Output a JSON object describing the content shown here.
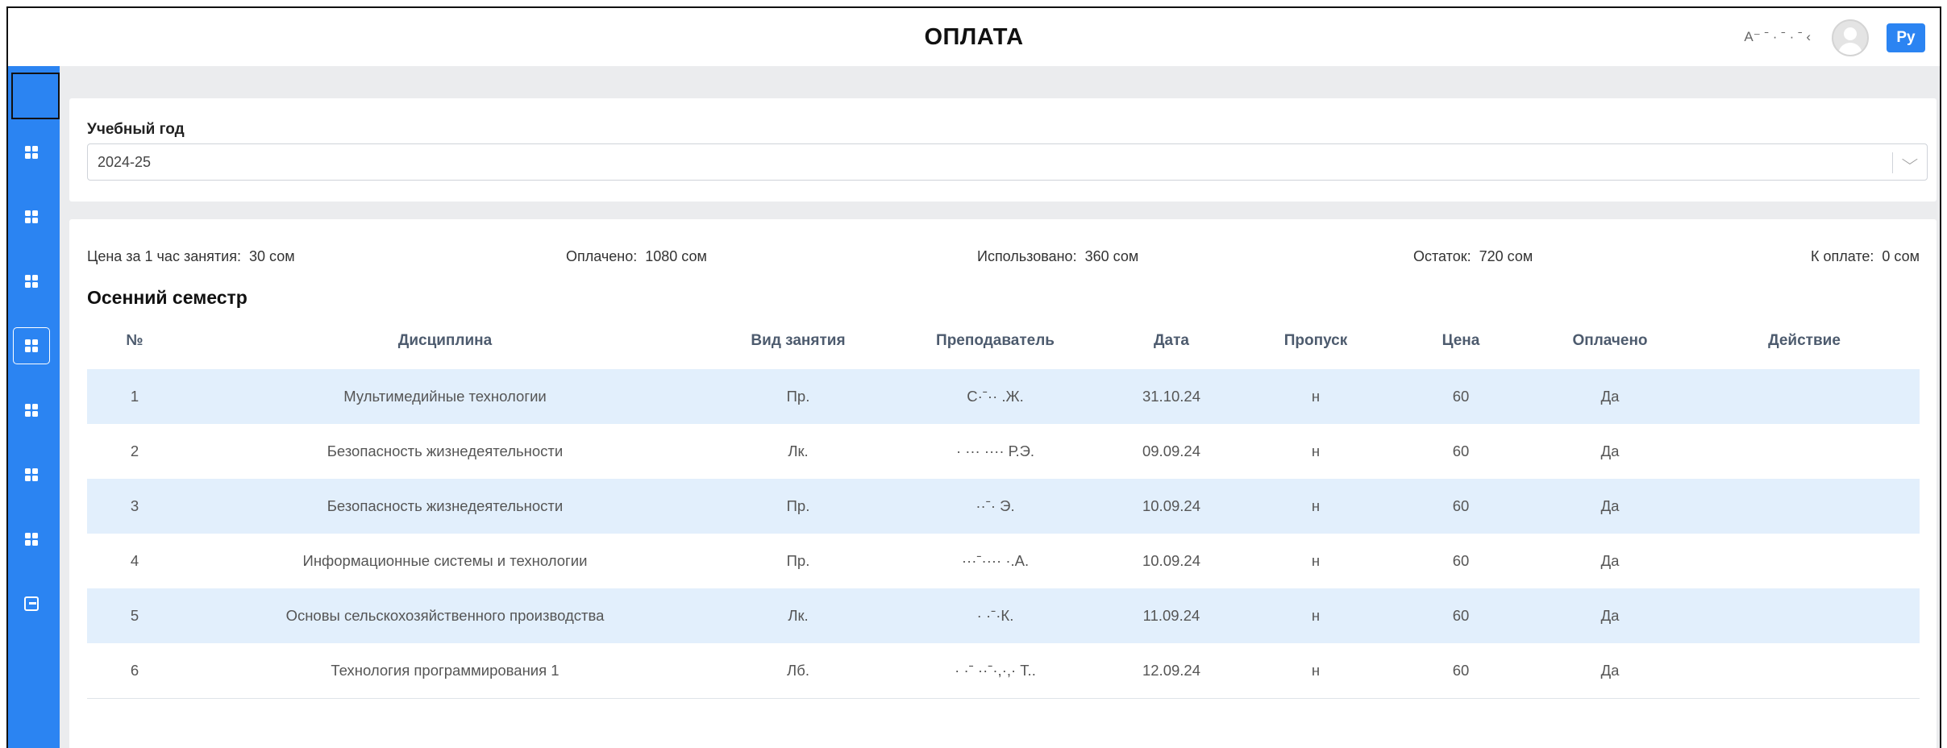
{
  "header": {
    "title": "ОПЛАТА",
    "user_name": "А⁻ ˉ · ˉ · ˉ  ‹",
    "lang_label": "Ру"
  },
  "sidebar": {
    "icons": [
      "grid-icon",
      "grid-icon",
      "grid-icon",
      "grid-icon",
      "grid-icon",
      "grid-icon",
      "grid-icon",
      "exit-icon"
    ],
    "active_index": 3
  },
  "filter": {
    "label": "Учебный год",
    "value": "2024-25",
    "chevron": "⌵"
  },
  "summary": {
    "price_label": "Цена за 1 час занятия:",
    "price_value": "30 сом",
    "paid_label": "Оплачено:",
    "paid_value": "1080 сом",
    "used_label": "Использовано:",
    "used_value": "360 сом",
    "rest_label": "Остаток:",
    "rest_value": "720 сом",
    "due_label": "К оплате:",
    "due_value": "0 сом"
  },
  "semester_title": "Осенний семестр",
  "table": {
    "headers": [
      "№",
      "Дисциплина",
      "Вид занятия",
      "Преподаватель",
      "Дата",
      "Пропуск",
      "Цена",
      "Оплачено",
      "Действие"
    ],
    "rows": [
      [
        "1",
        "Мультимедийные технологии",
        "Пр.",
        "С·ˉ··         .Ж.",
        "31.10.24",
        "н",
        "60",
        "Да",
        ""
      ],
      [
        "2",
        "Безопасность жизнедеятельности",
        "Лк.",
        "· ··· ···· Р.Э.",
        "09.09.24",
        "н",
        "60",
        "Да",
        ""
      ],
      [
        "3",
        "Безопасность жизнедеятельности",
        "Пр.",
        "··ˉ·        Э.",
        "10.09.24",
        "н",
        "60",
        "Да",
        ""
      ],
      [
        "4",
        "Информационные системы и технологии",
        "Пр.",
        "···ˉ···· ·.А.",
        "10.09.24",
        "н",
        "60",
        "Да",
        ""
      ],
      [
        "5",
        "Основы сельскохозяйственного производства",
        "Лк.",
        "·       ·ˉ·К.",
        "11.09.24",
        "н",
        "60",
        "Да",
        ""
      ],
      [
        "6",
        "Технология программирования 1",
        "Лб.",
        "· ·ˉ ··ˉ·,·,· Т..",
        "12.09.24",
        "н",
        "60",
        "Да",
        ""
      ]
    ]
  },
  "colors": {
    "accent": "#2b84f2",
    "row_highlight": "#e2effc",
    "background": "#ebecee"
  }
}
